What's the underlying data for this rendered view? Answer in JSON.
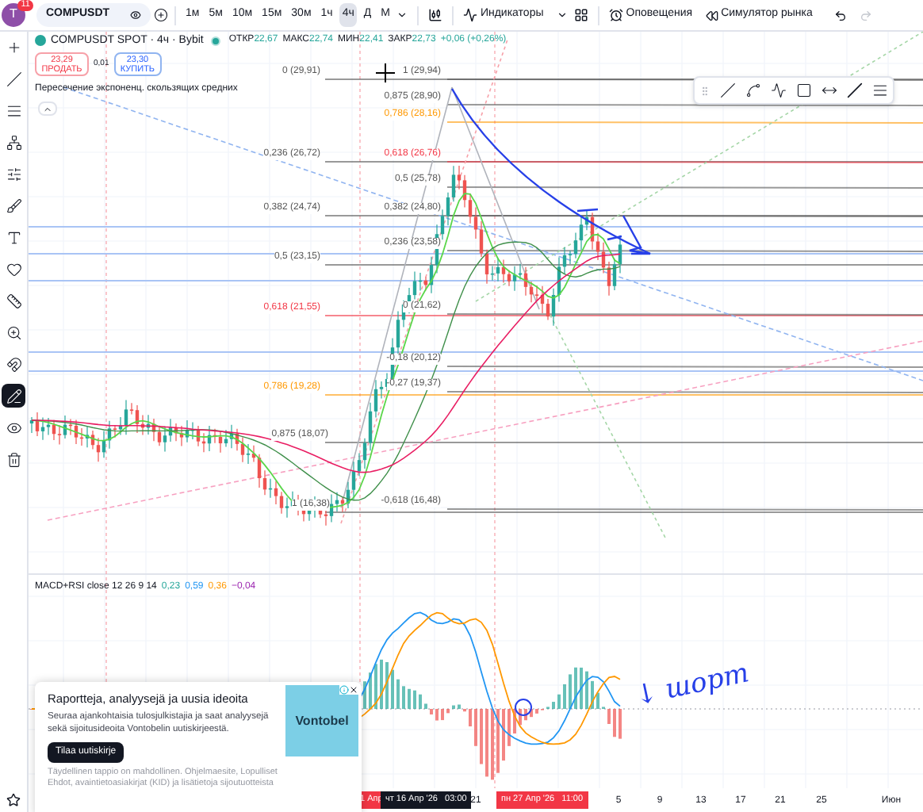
{
  "top_bar": {
    "avatar": "T",
    "notifications": "11",
    "symbol": "COMPUSDT",
    "intervals": [
      {
        "label": "1м",
        "selected": false
      },
      {
        "label": "5м",
        "selected": false
      },
      {
        "label": "10м",
        "selected": false
      },
      {
        "label": "15м",
        "selected": false
      },
      {
        "label": "30м",
        "selected": false
      },
      {
        "label": "1ч",
        "selected": false
      },
      {
        "label": "4ч",
        "selected": true
      },
      {
        "label": "Д",
        "selected": false
      },
      {
        "label": "М",
        "selected": false
      }
    ],
    "indicators": "Индикаторы",
    "alerts": "Оповещения",
    "simulator": "Симулятор рынка"
  },
  "tools": [
    {
      "kind": "cross",
      "selected": false
    },
    {
      "kind": "line",
      "selected": false
    },
    {
      "kind": "lines",
      "selected": false
    },
    {
      "kind": "pattern",
      "selected": false
    },
    {
      "kind": "forecast",
      "selected": false
    },
    {
      "kind": "brush",
      "selected": false
    },
    {
      "kind": "text",
      "selected": false
    },
    {
      "kind": "heart",
      "selected": false
    },
    {
      "kind": "ruler",
      "selected": false
    },
    {
      "kind": "zoom",
      "selected": false
    },
    {
      "kind": "magnet",
      "selected": false
    },
    {
      "kind": "lock",
      "selected": true
    },
    {
      "kind": "eye",
      "selected": false
    },
    {
      "kind": "trash",
      "selected": false
    }
  ],
  "legend": {
    "title": "COMPUSDT SPOT · 4ч · Bybit",
    "ohlc": [
      {
        "label": "ОТКР",
        "value": "22,67"
      },
      {
        "label": "МАКС",
        "value": "22,74"
      },
      {
        "label": "МИН",
        "value": "22,41"
      },
      {
        "label": "ЗАКР",
        "value": "22,73"
      }
    ],
    "change": "+0,06 (+0,26%)",
    "sell": {
      "price": "23,29",
      "label": "ПРОДАТЬ"
    },
    "spread": "0,01",
    "buy": {
      "price": "23,30",
      "label": "КУПИТЬ"
    },
    "indicator": "Пересечение экспоненц. скользящих средних"
  },
  "fib_labels_left": [
    {
      "text": "0 (29,91)",
      "color": "#555555"
    },
    {
      "text": "0,236 (26,72)",
      "color": "#555555"
    },
    {
      "text": "0,382 (24,74)",
      "color": "#555555"
    },
    {
      "text": "0,5 (23,15)",
      "color": "#555555"
    },
    {
      "text": "0,618 (21,55)",
      "color": "#f23645"
    },
    {
      "text": "0,786 (19,28)",
      "color": "#ff9800"
    },
    {
      "text": "0,875 (18,07)",
      "color": "#555555"
    },
    {
      "text": "1 (16,38)",
      "color": "#555555"
    }
  ],
  "fib_labels_right": [
    {
      "text": "1 (29,94)",
      "color": "#555555"
    },
    {
      "text": "0,875 (28,90)",
      "color": "#555555"
    },
    {
      "text": "0,786 (28,16)",
      "color": "#ff9800"
    },
    {
      "text": "0,618 (26,76)",
      "color": "#f23645"
    },
    {
      "text": "0,5 (25,78)",
      "color": "#555555"
    },
    {
      "text": "0,382 (24,80)",
      "color": "#555555"
    },
    {
      "text": "0,236 (23,58)",
      "color": "#555555"
    },
    {
      "text": "0 (21,62)",
      "color": "#555555"
    },
    {
      "text": "-0,18 (20,12)",
      "color": "#555555"
    },
    {
      "text": "-0,27 (19,37)",
      "color": "#555555"
    },
    {
      "text": "-0,618 (16,48)",
      "color": "#555555"
    }
  ],
  "annotation": "↓ шорт",
  "macd_legend": {
    "name": "MACD+RSI close 12 26 9 14",
    "values": [
      {
        "text": "0,23",
        "color": "#26a69a"
      },
      {
        "text": "0,59",
        "color": "#2196f3"
      },
      {
        "text": "0,36",
        "color": "#ff9800"
      },
      {
        "text": "−0,04",
        "color": "#9c27b0"
      }
    ]
  },
  "time_axis": [
    {
      "text": "1 Апр",
      "kind": "event"
    },
    {
      "text": "чт 16 Апр '26   03:00",
      "kind": "cursor"
    },
    {
      "text": "21",
      "kind": "tick"
    },
    {
      "text": "пн 27 Апр '26   11:00",
      "kind": "event"
    },
    {
      "text": "5",
      "kind": "tick"
    },
    {
      "text": "9",
      "kind": "tick"
    },
    {
      "text": "13",
      "kind": "tick"
    },
    {
      "text": "17",
      "kind": "tick"
    },
    {
      "text": "21",
      "kind": "tick"
    },
    {
      "text": "25",
      "kind": "tick"
    },
    {
      "text": "Июн",
      "kind": "tick"
    }
  ],
  "ad": {
    "title": "Raportteja, analyysejä ja uusia ideoita",
    "body": "Seuraa ajankohtaisia tulosjulkistajia ja saat analyysejä sekä sijoitusideoita Vontobelin uutiskirjeestä.",
    "button": "Tilaa uutiskirje",
    "disclaimer": "Täydellinen tappio on mahdollinen. Ohjelmaesite, Lopulliset Ehdot, avaintietoasiakirjat (KID) ja lisätietoja sijoutuotteista",
    "brand": "Vontobel"
  }
}
